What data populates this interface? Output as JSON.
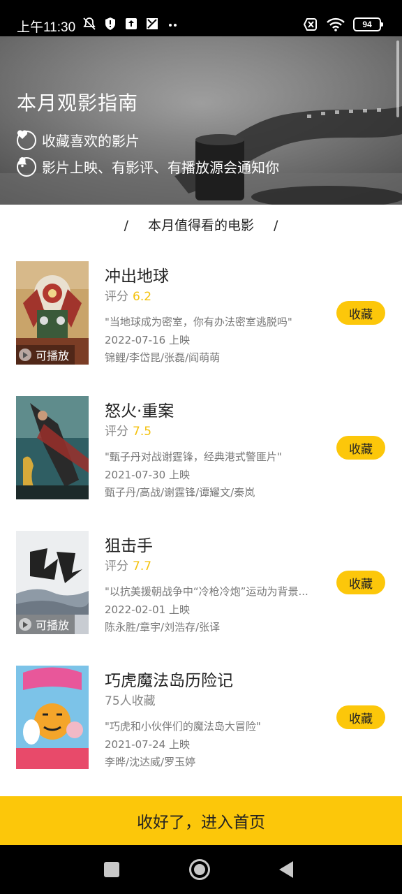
{
  "status_bar": {
    "time": "上午11:30",
    "battery": "94",
    "left_icons": [
      "bell-off-icon",
      "shield-alert-icon",
      "upload-icon",
      "app-icon",
      "more-dots-icon"
    ],
    "right_icons": [
      "no-sim-icon",
      "wifi-icon",
      "battery-icon"
    ]
  },
  "banner": {
    "title": "本月观影指南",
    "feature_fav": "收藏喜欢的影片",
    "feature_notify": "影片上映、有影评、有播放源会通知你"
  },
  "section": {
    "title": "本月值得看的电影",
    "slash_left": "/",
    "slash_right": "/"
  },
  "movies": [
    {
      "title": "冲出地球",
      "score_label": "评分",
      "score": "6.2",
      "quote": "\"当地球成为密室，你有办法密室逃脱吗\"",
      "release": "2022-07-16 上映",
      "cast": "锦鲤/李岱昆/张磊/阎萌萌",
      "playable": "可播放",
      "button": "收藏"
    },
    {
      "title": "怒火·重案",
      "score_label": "评分",
      "score": "7.5",
      "quote": "\"甄子丹对战谢霆锋，经典港式警匪片\"",
      "release": "2021-07-30 上映",
      "cast": "甄子丹/高战/谢霆锋/谭耀文/秦岚",
      "button": "收藏"
    },
    {
      "title": "狙击手",
      "score_label": "评分",
      "score": "7.7",
      "quote": "\"以抗美援朝战争中“冷枪冷炮”运动为背景...",
      "release": "2022-02-01 上映",
      "cast": "陈永胜/章宇/刘浩存/张译",
      "playable": "可播放",
      "button": "收藏"
    },
    {
      "title": "巧虎魔法岛历险记",
      "favorites": "75人收藏",
      "quote": "\"巧虎和小伙伴们的魔法岛大冒险\"",
      "release": "2021-07-24 上映",
      "cast": "李晔/沈达威/罗玉婷",
      "button": "收藏"
    }
  ],
  "cta": {
    "label": "收好了，进入首页"
  },
  "colors": {
    "accent": "#fcc70a",
    "score": "#f4c20d",
    "status_bar": "#000000"
  }
}
